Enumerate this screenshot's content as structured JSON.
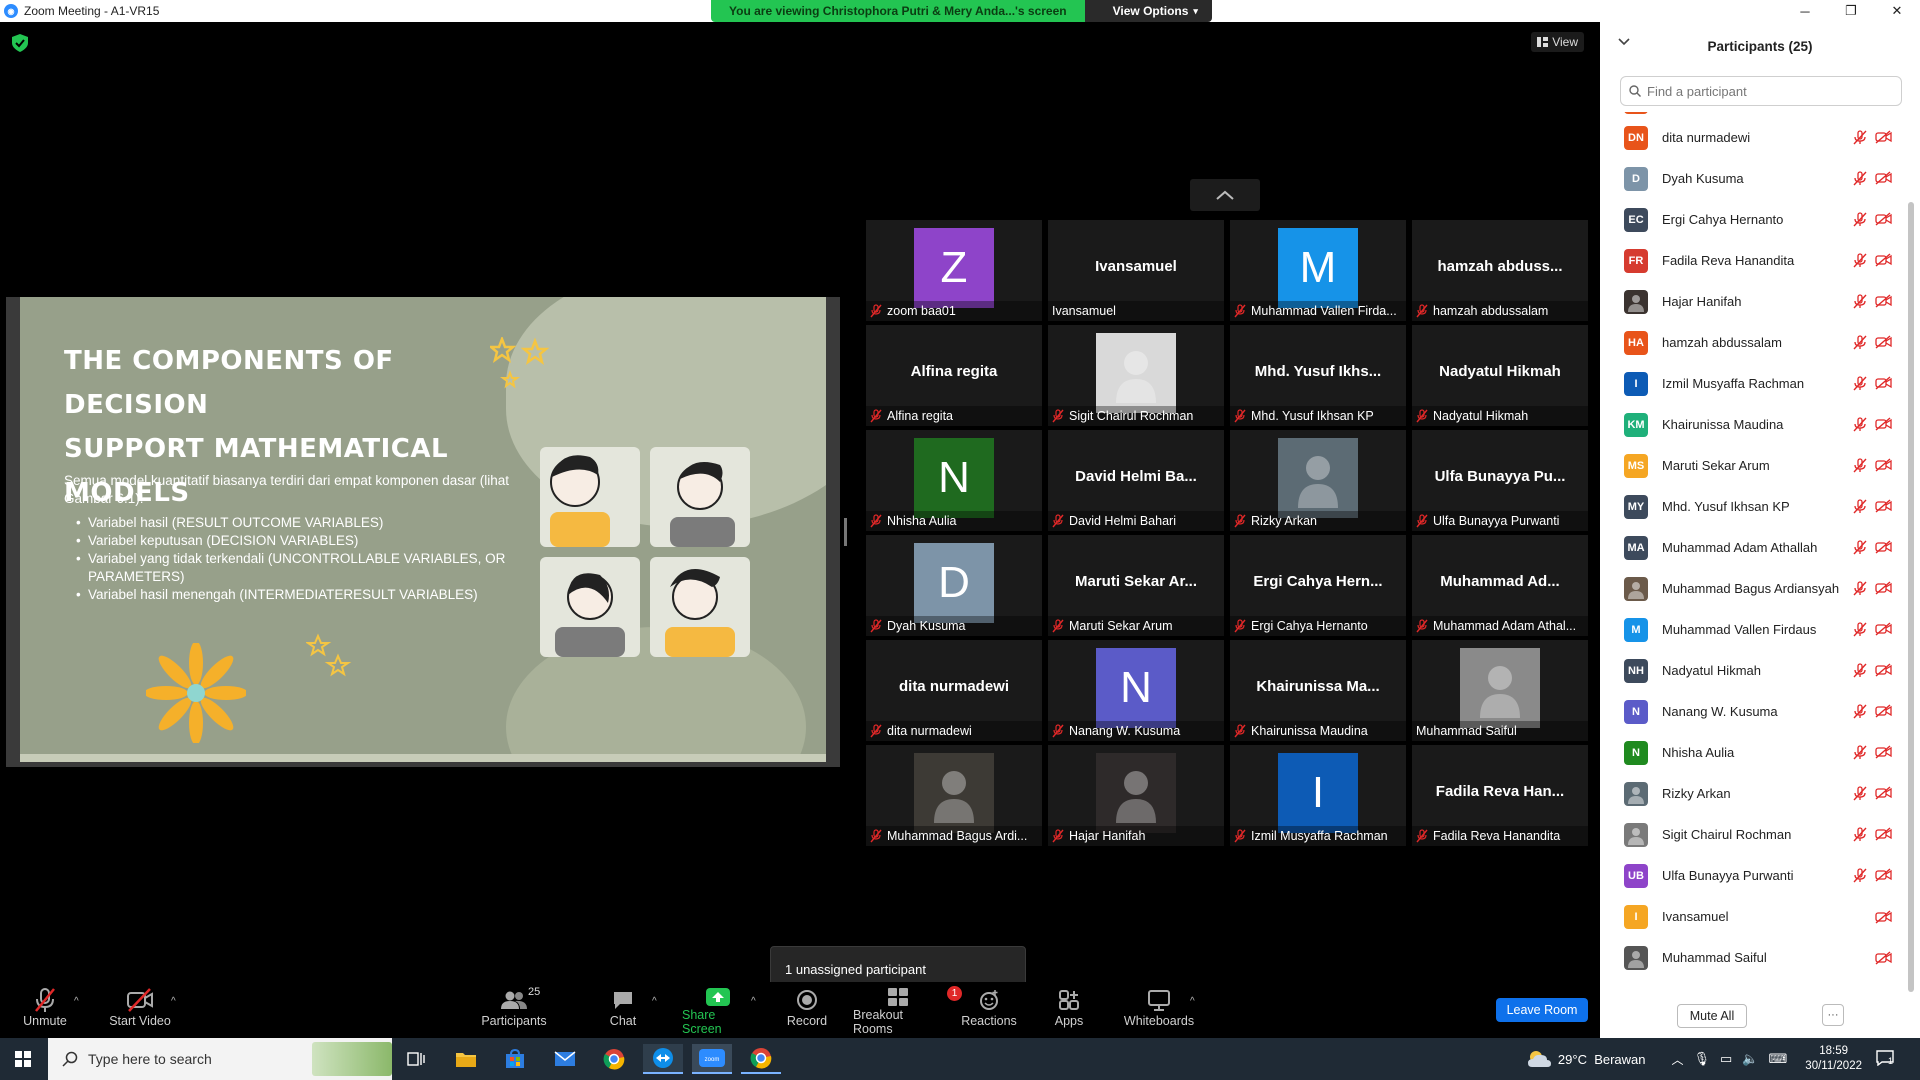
{
  "window": {
    "title": "Zoom Meeting - A1-VR15",
    "controls": [
      "─",
      "❐",
      "✕"
    ]
  },
  "share_banner": {
    "message": "You are viewing Christophora Putri & Mery Anda...'s screen",
    "view_options": "View Options"
  },
  "view_button": "View",
  "slide": {
    "title_lines": [
      "THE COMPONENTS OF DECISION",
      "SUPPORT MATHEMATICAL",
      "MODELS"
    ],
    "intro": "Semua model kuantitatif biasanya terdiri dari empat komponen dasar (lihat Gambar 6.1):",
    "bullets": [
      "Variabel hasil (RESULT OUTCOME VARIABLES)",
      "Variabel keputusan (DECISION VARIABLES)",
      "Variabel yang tidak terkendali  (UNCONTROLLABLE VARIABLES, OR PARAMETERS)",
      "Variabel hasil menengah (INTERMEDIATERESULT VARIABLES)"
    ]
  },
  "grid": {
    "tiles": [
      {
        "kind": "avatar",
        "initial": "Z",
        "color": "#8e44c9",
        "label": "zoom baa01",
        "muted": true
      },
      {
        "kind": "name",
        "big": "Ivansamuel",
        "label": "Ivansamuel",
        "muted": false
      },
      {
        "kind": "avatar",
        "initial": "M",
        "color": "#1693e8",
        "label": "Muhammad Vallen Firda...",
        "muted": true
      },
      {
        "kind": "name",
        "big": "hamzah abduss...",
        "label": "hamzah abdussalam",
        "muted": true
      },
      {
        "kind": "name",
        "big": "Alfina regita",
        "label": "Alfina regita",
        "muted": true
      },
      {
        "kind": "photo",
        "color": "#d9d9d9",
        "label": "Sigit Chairul Rochman",
        "muted": true
      },
      {
        "kind": "name",
        "big": "Mhd. Yusuf Ikhs...",
        "label": "Mhd. Yusuf Ikhsan KP",
        "muted": true
      },
      {
        "kind": "name",
        "big": "Nadyatul Hikmah",
        "label": "Nadyatul Hikmah",
        "muted": true
      },
      {
        "kind": "avatar",
        "initial": "N",
        "color": "#1f6a1f",
        "label": "Nhisha Aulia",
        "muted": true
      },
      {
        "kind": "name",
        "big": "David Helmi Ba...",
        "label": "David Helmi Bahari",
        "muted": true
      },
      {
        "kind": "photo",
        "color": "#5c6b74",
        "label": "Rizky Arkan",
        "muted": true
      },
      {
        "kind": "name",
        "big": "Ulfa Bunayya Pu...",
        "label": "Ulfa Bunayya Purwanti",
        "muted": true
      },
      {
        "kind": "avatar",
        "initial": "D",
        "color": "#7d94a8",
        "label": "Dyah Kusuma",
        "muted": true
      },
      {
        "kind": "name",
        "big": "Maruti Sekar Ar...",
        "label": "Maruti Sekar Arum",
        "muted": true
      },
      {
        "kind": "name",
        "big": "Ergi Cahya Hern...",
        "label": "Ergi Cahya Hernanto",
        "muted": true
      },
      {
        "kind": "name",
        "big": "Muhammad Ad...",
        "label": "Muhammad Adam Athal...",
        "muted": true
      },
      {
        "kind": "name",
        "big": "dita nurmadewi",
        "label": "dita nurmadewi",
        "muted": true
      },
      {
        "kind": "avatar",
        "initial": "N",
        "color": "#5b5bc8",
        "label": "Nanang W. Kusuma",
        "muted": true
      },
      {
        "kind": "name",
        "big": "Khairunissa Ma...",
        "label": "Khairunissa Maudina",
        "muted": true
      },
      {
        "kind": "photo",
        "color": "#8a8a8a",
        "label": "Muhammad Saiful",
        "muted": false
      },
      {
        "kind": "photo",
        "color": "#3d3a35",
        "label": "Muhammad Bagus Ardi...",
        "muted": true
      },
      {
        "kind": "photo",
        "color": "#2e2a2a",
        "label": "Hajar Hanifah",
        "muted": true
      },
      {
        "kind": "avatar",
        "initial": "I",
        "color": "#0d5bb5",
        "label": "Izmil Musyaffa Rachman",
        "muted": true
      },
      {
        "kind": "name",
        "big": "Fadila Reva Han...",
        "label": "Fadila Reva Hanandita",
        "muted": true
      }
    ]
  },
  "toast": "1 unassigned participant",
  "toolbar": {
    "unmute": "Unmute",
    "start_video": "Start Video",
    "participants": "Participants",
    "participants_count": "25",
    "chat": "Chat",
    "share_screen": "Share Screen",
    "record": "Record",
    "breakout_rooms": "Breakout Rooms",
    "breakout_badge": "1",
    "reactions": "Reactions",
    "apps": "Apps",
    "whiteboards": "Whiteboards",
    "leave": "Leave Room"
  },
  "panel": {
    "title": "Participants (25)",
    "search_placeholder": "Find a participant",
    "participants": [
      {
        "initials": "DN",
        "color": "#e8541a",
        "name": "dita nurmadewi",
        "muted": true
      },
      {
        "initials": "D",
        "color": "#7d94a8",
        "name": "Dyah Kusuma",
        "muted": true
      },
      {
        "initials": "EC",
        "color": "#3d4a5c",
        "name": "Ergi Cahya Hernanto",
        "muted": true
      },
      {
        "initials": "FR",
        "color": "#d63b2f",
        "name": "Fadila Reva Hanandita",
        "muted": true
      },
      {
        "initials": "",
        "color": "#3b3330",
        "name": "Hajar Hanifah",
        "muted": true
      },
      {
        "initials": "HA",
        "color": "#e8541a",
        "name": "hamzah abdussalam",
        "muted": true
      },
      {
        "initials": "I",
        "color": "#0d5bb5",
        "name": "Izmil Musyaffa Rachman",
        "muted": true
      },
      {
        "initials": "KM",
        "color": "#1fb07a",
        "name": "Khairunissa Maudina",
        "muted": true
      },
      {
        "initials": "MS",
        "color": "#f5a623",
        "name": "Maruti Sekar Arum",
        "muted": true
      },
      {
        "initials": "MY",
        "color": "#3d4a5c",
        "name": "Mhd. Yusuf Ikhsan KP",
        "muted": true
      },
      {
        "initials": "MA",
        "color": "#3d4a5c",
        "name": "Muhammad Adam Athallah",
        "muted": true
      },
      {
        "initials": "",
        "color": "#6b5a4a",
        "name": "Muhammad Bagus Ardiansyah",
        "muted": true
      },
      {
        "initials": "M",
        "color": "#1693e8",
        "name": "Muhammad Vallen Firdaus",
        "muted": true
      },
      {
        "initials": "NH",
        "color": "#3d4a5c",
        "name": "Nadyatul Hikmah",
        "muted": true
      },
      {
        "initials": "N",
        "color": "#5b5bc8",
        "name": "Nanang W. Kusuma",
        "muted": true
      },
      {
        "initials": "N",
        "color": "#1f8a1f",
        "name": "Nhisha Aulia",
        "muted": true
      },
      {
        "initials": "",
        "color": "#5c6b74",
        "name": "Rizky Arkan",
        "muted": true
      },
      {
        "initials": "",
        "color": "#7a7a7a",
        "name": "Sigit Chairul Rochman",
        "muted": true
      },
      {
        "initials": "UB",
        "color": "#8e44c9",
        "name": "Ulfa Bunayya Purwanti",
        "muted": true
      },
      {
        "initials": "I",
        "color": "#f5a623",
        "name": "Ivansamuel",
        "muted": false
      },
      {
        "initials": "",
        "color": "#555555",
        "name": "Muhammad Saiful",
        "muted": false
      }
    ],
    "mute_all": "Mute All",
    "more": "···"
  },
  "taskbar": {
    "search_placeholder": "Type here to search",
    "weather": "29°C  Berawan",
    "time": "18:59",
    "date": "30/11/2022",
    "notif_count": "1"
  },
  "colors": {
    "zoom_blue": "#0e71eb",
    "share_green": "#23c552",
    "mic_red": "#e02828"
  }
}
